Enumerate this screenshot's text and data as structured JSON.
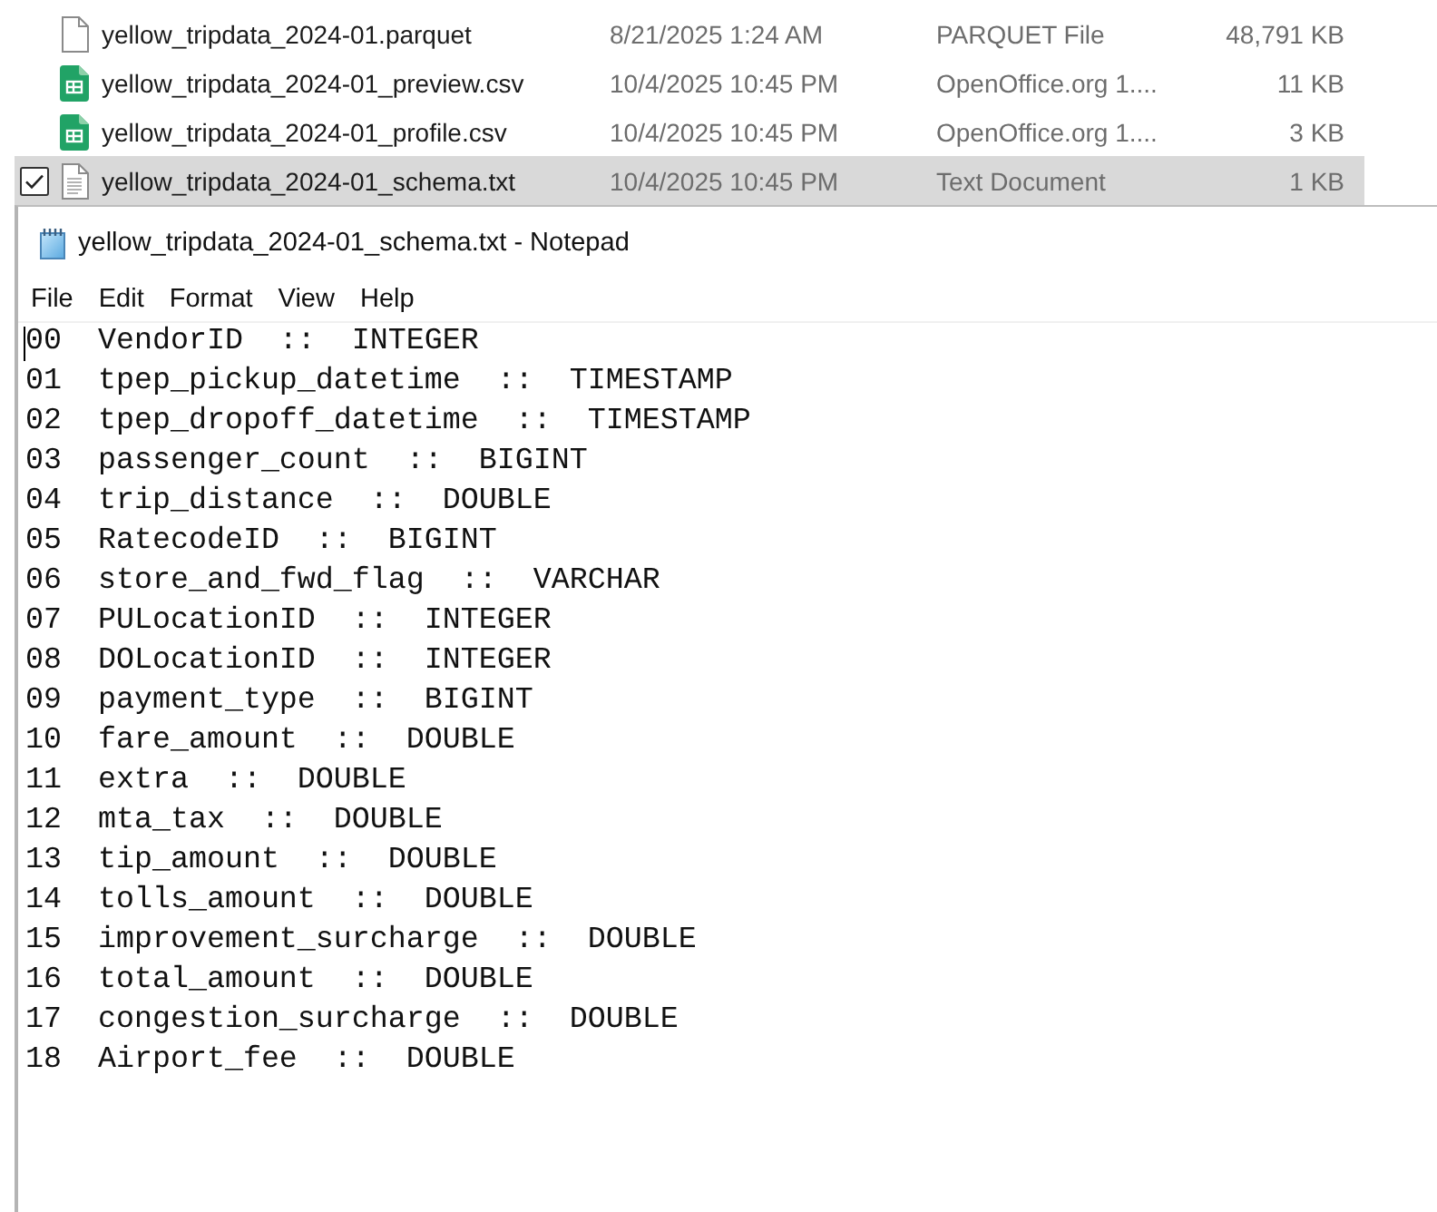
{
  "file_list": [
    {
      "name": "yellow_tripdata_2024-01.parquet",
      "date_modified": "8/21/2025 1:24 AM",
      "type": "PARQUET File",
      "size": "48,791 KB",
      "kind": "blank",
      "selected": false,
      "checked": false
    },
    {
      "name": "yellow_tripdata_2024-01_preview.csv",
      "date_modified": "10/4/2025 10:45 PM",
      "type": "OpenOffice.org 1....",
      "size": "11 KB",
      "kind": "spreadsheet",
      "selected": false,
      "checked": false
    },
    {
      "name": "yellow_tripdata_2024-01_profile.csv",
      "date_modified": "10/4/2025 10:45 PM",
      "type": "OpenOffice.org 1....",
      "size": "3 KB",
      "kind": "spreadsheet",
      "selected": false,
      "checked": false
    },
    {
      "name": "yellow_tripdata_2024-01_schema.txt",
      "date_modified": "10/4/2025 10:45 PM",
      "type": "Text Document",
      "size": "1 KB",
      "kind": "text",
      "selected": true,
      "checked": true
    }
  ],
  "notepad": {
    "title": "yellow_tripdata_2024-01_schema.txt - Notepad",
    "menu": [
      "File",
      "Edit",
      "Format",
      "View",
      "Help"
    ],
    "lines": [
      "00  VendorID  ::  INTEGER",
      "01  tpep_pickup_datetime  ::  TIMESTAMP",
      "02  tpep_dropoff_datetime  ::  TIMESTAMP",
      "03  passenger_count  ::  BIGINT",
      "04  trip_distance  ::  DOUBLE",
      "05  RatecodeID  ::  BIGINT",
      "06  store_and_fwd_flag  ::  VARCHAR",
      "07  PULocationID  ::  INTEGER",
      "08  DOLocationID  ::  INTEGER",
      "09  payment_type  ::  BIGINT",
      "10  fare_amount  ::  DOUBLE",
      "11  extra  ::  DOUBLE",
      "12  mta_tax  ::  DOUBLE",
      "13  tip_amount  ::  DOUBLE",
      "14  tolls_amount  ::  DOUBLE",
      "15  improvement_surcharge  ::  DOUBLE",
      "16  total_amount  ::  DOUBLE",
      "17  congestion_surcharge  ::  DOUBLE",
      "18  Airport_fee  ::  DOUBLE"
    ]
  }
}
